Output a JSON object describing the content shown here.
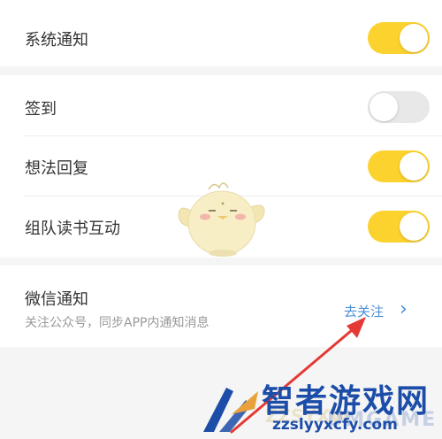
{
  "settings": [
    {
      "label": "系统通知",
      "enabled": true
    },
    {
      "label": "签到",
      "enabled": false
    },
    {
      "label": "想法回复",
      "enabled": true
    },
    {
      "label": "组队读书互动",
      "enabled": true
    }
  ],
  "wechat": {
    "title": "微信通知",
    "subtitle": "关注公众号，同步APP内通知消息",
    "action_label": "去关注",
    "chevron": "›"
  },
  "watermark": {
    "title": "智者游戏网",
    "url": "zzslyyxcfy.com",
    "ghost_text": "DMGAME",
    "ghost_text2": "ZZSYXW"
  },
  "colors": {
    "toggle_on": "#fcd22f",
    "toggle_off": "#e8e8e8",
    "link": "#4a8fd9",
    "arrow": "#e53935"
  },
  "icons": {
    "chevron": "chevron-right-icon",
    "mascot": "mascot-chick-icon",
    "arrow": "red-annotation-arrow",
    "logo": "site-logo"
  }
}
